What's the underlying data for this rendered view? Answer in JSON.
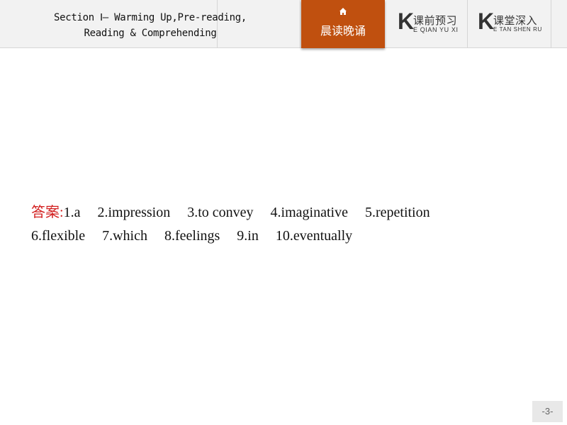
{
  "header": {
    "title_line1": "Section Ⅰ— Warming Up,Pre-reading,",
    "title_line2": "Reading & Comprehending",
    "tabs": [
      {
        "label": "晨读晚诵",
        "icon": "home-icon",
        "active": true
      },
      {
        "label": "课前预习",
        "prefix": "K",
        "pinyin": "E QIAN YU XI",
        "active": false
      },
      {
        "label": "课堂深入",
        "prefix": "K",
        "pinyin": "E TAN SHEN RU",
        "active": false
      }
    ]
  },
  "answers": {
    "label": "答案:",
    "line1": [
      "1.a",
      "2.impression",
      "3.to convey",
      "4.imaginative",
      "5.repetition"
    ],
    "line2": [
      "6.flexible",
      "7.which",
      "8.feelings",
      "9.in",
      "10.eventually"
    ]
  },
  "footer": {
    "page_number": "-3-"
  },
  "colors": {
    "accent": "#c0500f",
    "answer_label": "#d21e1e"
  }
}
